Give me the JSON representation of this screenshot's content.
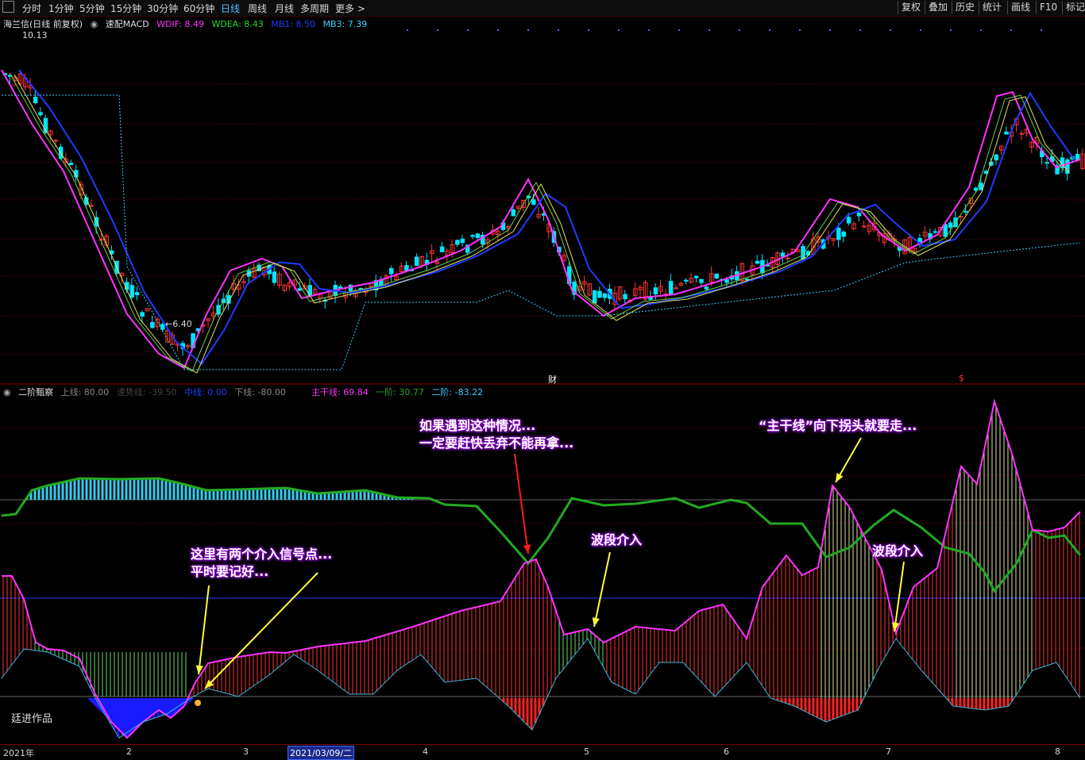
{
  "toolbar": {
    "period_tabs": [
      "分时",
      "1分钟",
      "5分钟",
      "15分钟",
      "30分钟",
      "60分钟",
      "日线",
      "周线",
      "月线",
      "多周期",
      "更多 >"
    ],
    "active_tab": "日线",
    "right_buttons": [
      "复权",
      "叠加",
      "历史",
      "统计",
      "画线",
      "F10",
      "标记"
    ]
  },
  "upper_info": {
    "stock_title": "海兰信(日线 前复权)",
    "indicator_name": "速配MACD",
    "wdif": "WDIF: 8.49",
    "wdea": "WDEA: 8.43",
    "mb1": "MB1: 8.50",
    "mb3": "MB3: 7.39"
  },
  "price_labels": {
    "high": "10.13",
    "low": "←6.40"
  },
  "event_markers": {
    "cai": "财",
    "s": "$"
  },
  "lower_info": {
    "indicator_name": "二阶甄察",
    "upper_line": "上线: 80.00",
    "speed_line": "速势线: -39.50",
    "mid_line": "中线: 0.00",
    "lower_line": "下线: -80.00",
    "main_line": "主干线: 69.84",
    "first_order": "一阶: 30.77",
    "second_order": "二阶: -83.22"
  },
  "watermark": "廷进作品",
  "annotations": {
    "a1_line1": "这里有两个介入信号点...",
    "a1_line2": "平时要记好...",
    "a2_line1": "如果遇到这种情况...",
    "a2_line2": "一定要赶快丢弃不能再拿...",
    "a3": "波段介入",
    "a4": "“主干线”向下拐头就要走...",
    "a5": "波段介入"
  },
  "date_axis": {
    "labels": [
      "2021年",
      "2",
      "3",
      "4",
      "5",
      "6",
      "7",
      "8"
    ],
    "cursor_date": "2021/03/09/二"
  },
  "colors": {
    "up": "#ff3333",
    "down": "#00e5ff",
    "pink": "#ff33ff",
    "blue": "#1e3cff",
    "green": "#22aa22",
    "cyan": "#39d0ff"
  },
  "chart_data": {
    "type": "candlestick",
    "indicator_lines": [
      "WDIF",
      "WDEA",
      "MB1",
      "MB3"
    ],
    "price_extremes": {
      "high": 10.13,
      "low": 6.4
    },
    "lower_indicator": {
      "name": "二阶甄察",
      "levels": {
        "upper": 80.0,
        "mid": 0.0,
        "lower": -80.0
      },
      "current": {
        "speed_line": -39.5,
        "main_line": 69.84,
        "first_order": 30.77,
        "second_order": -83.22
      }
    },
    "x_axis_months": [
      "2021年",
      "2",
      "3",
      "4",
      "5",
      "6",
      "7",
      "8"
    ]
  }
}
